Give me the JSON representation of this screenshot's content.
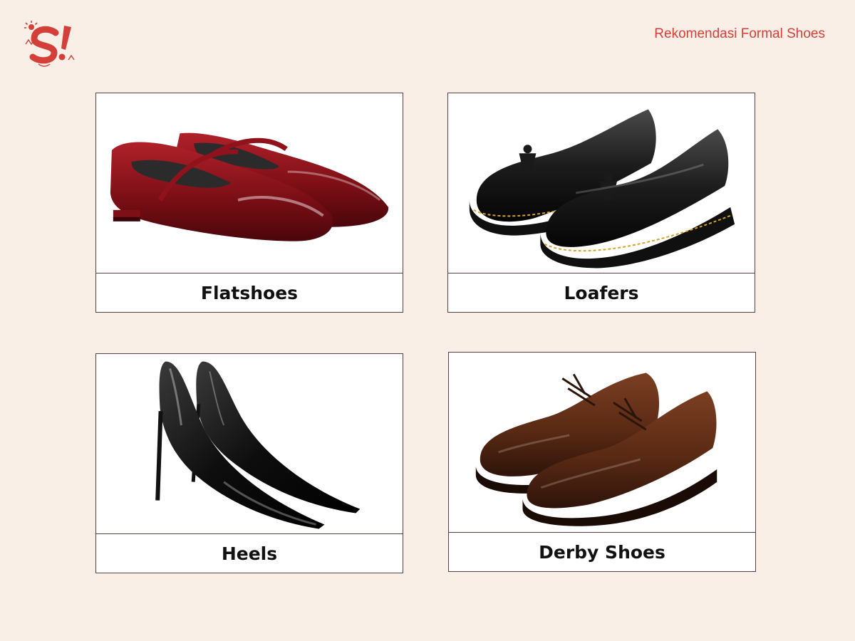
{
  "header": {
    "title": "Rekomendasi Formal Shoes",
    "brand_color": "#d43f3a"
  },
  "logo": {
    "icon": "brand-logo-icon"
  },
  "cards": [
    {
      "label": "Flatshoes",
      "icon": "red-patent-mary-jane-flat-icon"
    },
    {
      "label": "Loafers",
      "icon": "black-tassel-loafer-icon"
    },
    {
      "label": "Heels",
      "icon": "black-patent-stiletto-pump-icon"
    },
    {
      "label": "Derby Shoes",
      "icon": "brown-leather-derby-shoe-icon"
    }
  ]
}
